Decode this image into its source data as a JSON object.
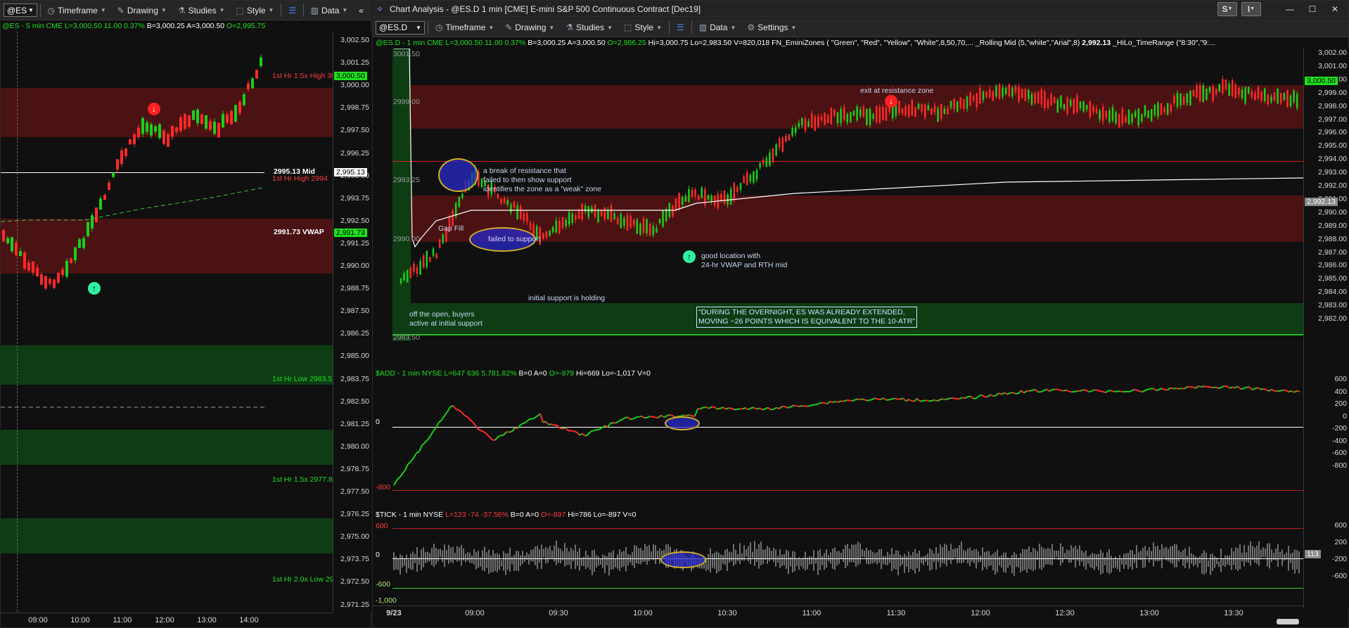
{
  "left": {
    "toolbar": {
      "symbol": "@ES",
      "timeframe": "Timeframe",
      "drawing": "Drawing",
      "studies": "Studies",
      "style": "Style",
      "data": "Data"
    },
    "info": {
      "symbol": "@ES - 5 min  CME",
      "last": "L=3,000.50",
      "change": "11.00",
      "pct": "0.37%",
      "bid": "B=3,000.25",
      "ask": "A=3,000.50",
      "open": "O=2,995.75"
    },
    "price_axis": [
      "3,002.50",
      "3,001.25",
      "3,000.00",
      "2,998.75",
      "2,997.50",
      "2,996.25",
      "2,995.00",
      "2,993.75",
      "2,992.50",
      "2,991.25",
      "2,990.00",
      "2,988.75",
      "2,987.50",
      "2,986.25",
      "2,985.00",
      "2,983.75",
      "2,982.50",
      "2,981.25",
      "2,980.00",
      "2,978.75",
      "2,977.50",
      "2,976.25",
      "2,975.00",
      "2,973.75",
      "2,972.50",
      "2,971.25"
    ],
    "time_axis": [
      "09:00",
      "10:00",
      "11:00",
      "12:00",
      "13:00",
      "14:00"
    ],
    "tags": {
      "last": "3,000.50",
      "mid": "2,995.13",
      "vwap": "2,991.73"
    },
    "labels": {
      "hr_high_15x": "1st Hr 1.5x High 30",
      "mid": "2995.13 Mid",
      "hr_high": "1st Hr High 2994",
      "vwap": "2991.73 VWAP",
      "hr_low": "1st Hr Low 2983.5",
      "hr_low_15x": "1st Hr 1.5x 2977.8",
      "hr_low_2x": "1st Hr 2.0x Low 29"
    }
  },
  "right": {
    "title": "Chart Analysis - @ES.D 1 min [CME] E-mini S&P 500 Continuous Contract [Dec19]",
    "window_buttons": {
      "s": "S",
      "i": "I"
    },
    "toolbar": {
      "symbol": "@ES.D",
      "timeframe": "Timeframe",
      "drawing": "Drawing",
      "studies": "Studies",
      "style": "Style",
      "data": "Data",
      "settings": "Settings"
    },
    "info": {
      "symbol": "@ES.D - 1 min  CME",
      "last": "L=3,000.50",
      "change": "11.00",
      "pct": "0.37%",
      "bid": "B=3,000.25",
      "ask": "A=3,000.50",
      "open": "O=2,986.25",
      "high": "Hi=3,000.75",
      "low": "Lo=2,983.50",
      "vol": "V=820,018",
      "study1": "FN_EminiZones ( \"Green\", \"Red\", \"Yellow\", \"White\",8,50,70,...",
      "study2": "_Rolling Mid (5,\"white\",\"Arial\",8)",
      "study2_val": "2,992.13",
      "study3": "_HiLo_TimeRange (\"8:30\",\"9:..."
    },
    "price_axis": [
      "3,002.00",
      "3,001.00",
      "3,000.00",
      "2,999.00",
      "2,998.00",
      "2,997.00",
      "2,996.00",
      "2,995.00",
      "2,994.00",
      "2,993.00",
      "2,992.00",
      "2,991.00",
      "2,990.00",
      "2,989.00",
      "2,988.00",
      "2,987.00",
      "2,986.00",
      "2,985.00",
      "2,984.00",
      "2,983.00",
      "2,982.00"
    ],
    "price_tags": {
      "last": "3,000.50",
      "mid": "2,992.13"
    },
    "level_labels": {
      "l3001": "3001.50",
      "l2999": "2999.00",
      "l2993": "2993.25",
      "l2990": "2990.00",
      "l2983": "2983.50"
    },
    "annotations": {
      "exit": "exit at resistance zone",
      "break1": "a break of resistance that",
      "break2": "failed to then show support",
      "break3": "identifies the zone as a \"weak\" zone",
      "gap": "Gap Fill",
      "failed": "failed to support",
      "good1": "good location with",
      "good2": "24-hr VWAP and RTH mid",
      "holding": "initial support is holding",
      "open1": "off the open, buyers",
      "open2": "active at initial support",
      "box1": "\"DURING THE OVERNIGHT, ES WAS ALREADY EXTENDED,",
      "box2": "MOVING ~26 POINTS WHICH IS EQUIVALENT TO THE 10-ATR\""
    },
    "add": {
      "symbol": "$ADD - 1 min  NYSE",
      "last": "L=647",
      "change": "636",
      "pct": "5,781.82%",
      "bid": "B=0",
      "ask": "A=0",
      "open": "O=-979",
      "high": "Hi=669",
      "low": "Lo=-1,017",
      "vol": "V=0",
      "axis": [
        "600",
        "400",
        "200",
        "0",
        "-200",
        "-400",
        "-600",
        "-800"
      ],
      "zero": "0",
      "minus800": "-800"
    },
    "tick": {
      "symbol": "$TICK - 1 min  NYSE",
      "last": "L=123",
      "change": "-74",
      "pct": "-37.56%",
      "bid": "B=0",
      "ask": "A=0",
      "open": "O=-897",
      "high": "Hi=786",
      "low": "Lo=-897",
      "vol": "V=0",
      "axis": [
        "600",
        "200",
        "-200",
        "-600"
      ],
      "tag": "113",
      "l600": "600",
      "zero": "0",
      "m600": "-600",
      "m1000": "-1,000"
    },
    "time_axis": [
      "9/23",
      "09:00",
      "09:30",
      "10:00",
      "10:30",
      "11:00",
      "11:30",
      "12:00",
      "12:30",
      "13:00",
      "13:30"
    ]
  },
  "colors": {
    "green": "#1ee01e",
    "red": "#ff3a3a",
    "zone_red": "#4a1212",
    "zone_green": "#0e3d14"
  }
}
